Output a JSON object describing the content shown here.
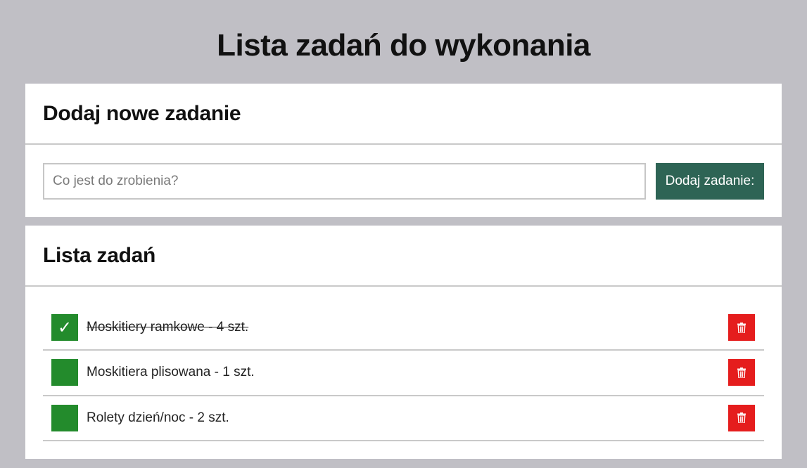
{
  "page": {
    "title": "Lista zadań do wykonania"
  },
  "add_section": {
    "heading": "Dodaj nowe zadanie",
    "input_placeholder": "Co jest do zrobienia?",
    "input_value": "",
    "button_label": "Dodaj zadanie:"
  },
  "list_section": {
    "heading": "Lista zadań",
    "tasks": [
      {
        "text": "Moskitiery ramkowe - 4 szt.",
        "done": true,
        "check_mark": "✓"
      },
      {
        "text": "Moskitiera plisowana - 1 szt.",
        "done": false,
        "check_mark": ""
      },
      {
        "text": "Rolety dzień/noc - 2 szt.",
        "done": false,
        "check_mark": ""
      }
    ]
  },
  "icons": {
    "check": "check-icon",
    "delete": "trash-icon"
  },
  "colors": {
    "background": "#c0bfc5",
    "add_button": "#2e6455",
    "check_box": "#238b2c",
    "delete_button": "#e51d1d"
  }
}
